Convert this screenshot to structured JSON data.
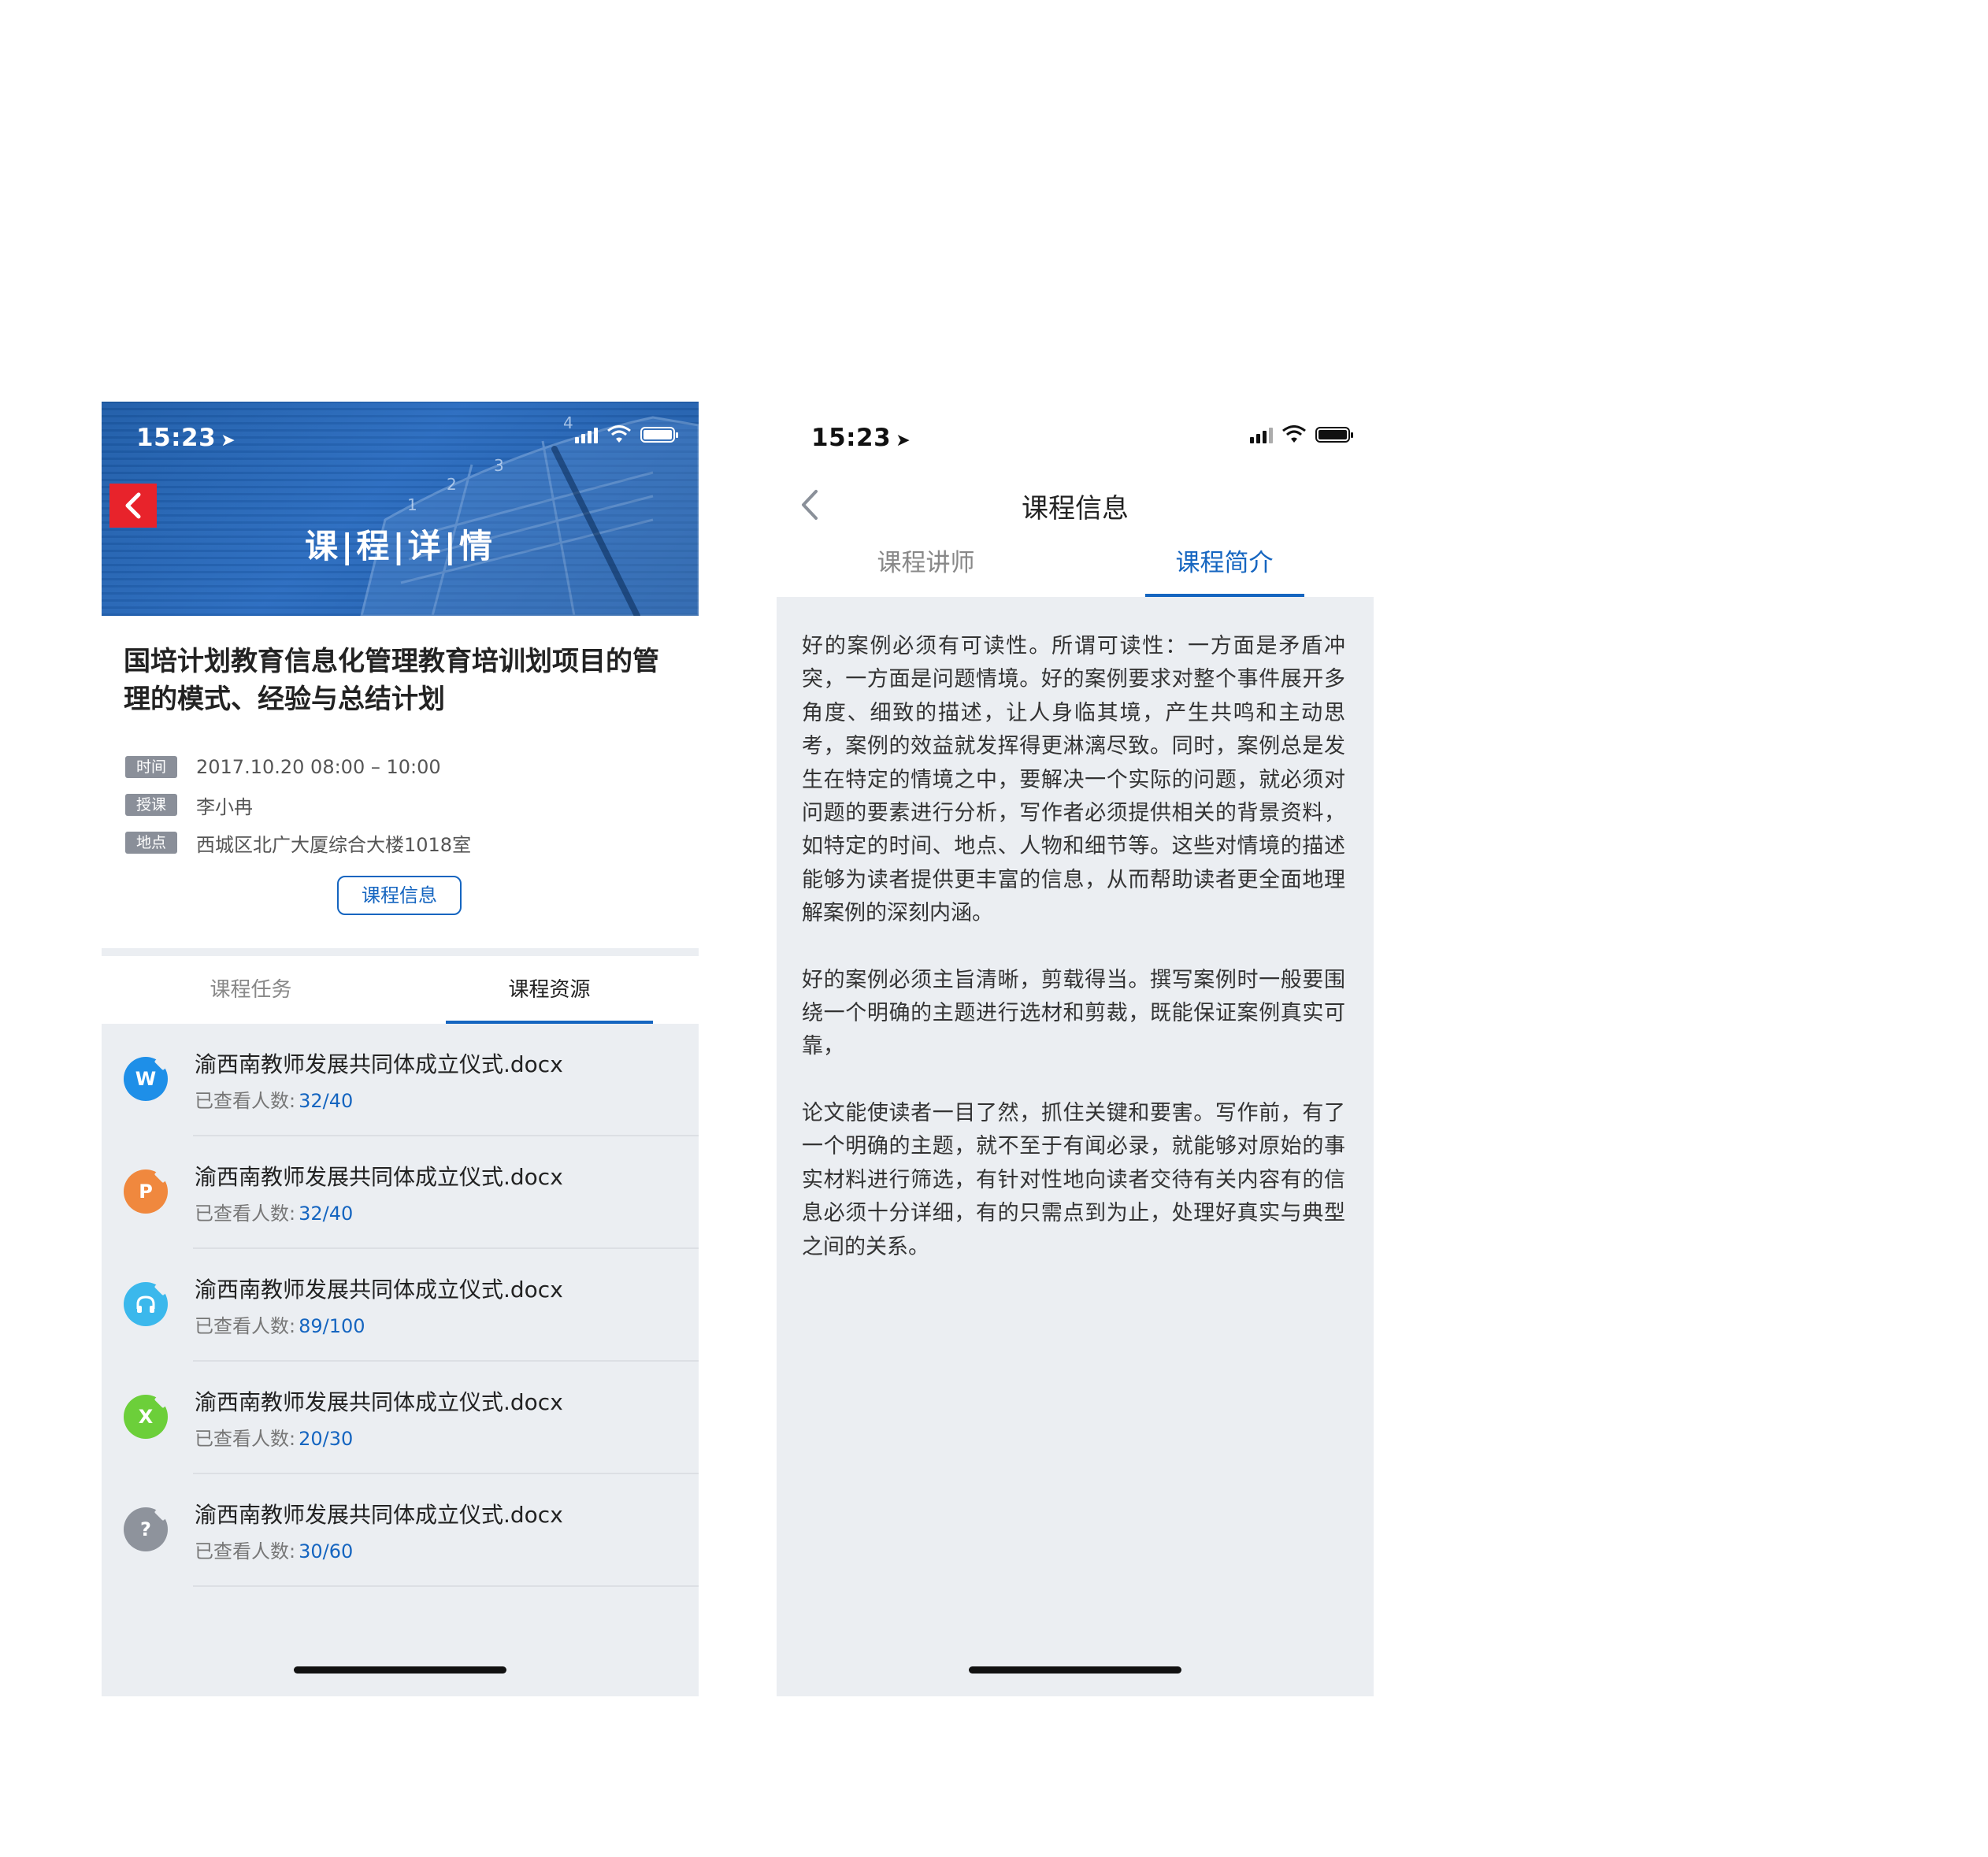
{
  "phone1": {
    "status": {
      "time": "15:23"
    },
    "banner_title": "课|程|详|情",
    "course_title": "国培计划教育信息化管理教育培训划项目的管理的模式、经验与总结计划",
    "meta": [
      {
        "tag": "时间",
        "value": "2017.10.20 08:00 – 10:00"
      },
      {
        "tag": "授课",
        "value": "李小冉"
      },
      {
        "tag": "地点",
        "value": "西城区北广大厦综合大楼1018室"
      }
    ],
    "info_button": "课程信息",
    "tabs": [
      {
        "label": "课程任务"
      },
      {
        "label": "课程资源"
      }
    ],
    "files": [
      {
        "icon": "word-icon",
        "glyph": "W",
        "color": "#1e8fe8",
        "name": "渝西南教师发展共同体成立仪式.docx",
        "view_label": "已查看人数:",
        "view_count": "32/40"
      },
      {
        "icon": "ppt-icon",
        "glyph": "P",
        "color": "#f0883e",
        "name": "渝西南教师发展共同体成立仪式.docx",
        "view_label": "已查看人数:",
        "view_count": "32/40"
      },
      {
        "icon": "audio-icon",
        "glyph": "",
        "color": "#3bb8ec",
        "name": "渝西南教师发展共同体成立仪式.docx",
        "view_label": "已查看人数:",
        "view_count": "89/100"
      },
      {
        "icon": "excel-icon",
        "glyph": "X",
        "color": "#6ccf3a",
        "name": "渝西南教师发展共同体成立仪式.docx",
        "view_label": "已查看人数:",
        "view_count": "20/30"
      },
      {
        "icon": "unknown-file-icon",
        "glyph": "?",
        "color": "#8e939c",
        "name": "渝西南教师发展共同体成立仪式.docx",
        "view_label": "已查看人数:",
        "view_count": "30/60"
      }
    ]
  },
  "phone2": {
    "status": {
      "time": "15:23"
    },
    "title": "课程信息",
    "tabs": [
      {
        "label": "课程讲师"
      },
      {
        "label": "课程简介"
      }
    ],
    "paragraphs": [
      "好的案例必须有可读性。所谓可读性：一方面是矛盾冲突，一方面是问题情境。好的案例要求对整个事件展开多角度、细致的描述，让人身临其境，产生共鸣和主动思考，案例的效益就发挥得更淋漓尽致。同时，案例总是发生在特定的情境之中，要解决一个实际的问题，就必须对问题的要素进行分析，写作者必须提供相关的背景资料，如特定的时间、地点、人物和细节等。这些对情境的描述能够为读者提供更丰富的信息，从而帮助读者更全面地理解案例的深刻内涵。",
      "好的案例必须主旨清晰，剪载得当。撰写案例时一般要围绕一个明确的主题进行选材和剪裁，既能保证案例真实可靠，",
      "论文能使读者一目了然，抓住关键和要害。写作前，有了一个明确的主题，就不至于有闻必录，就能够对原始的事实材料进行筛选，有针对性地向读者交待有关内容有的信息必须十分详细，有的只需点到为止，处理好真实与典型之间的关系。"
    ]
  },
  "colors": {
    "accent": "#1565c0",
    "back_red": "#e8232b"
  }
}
